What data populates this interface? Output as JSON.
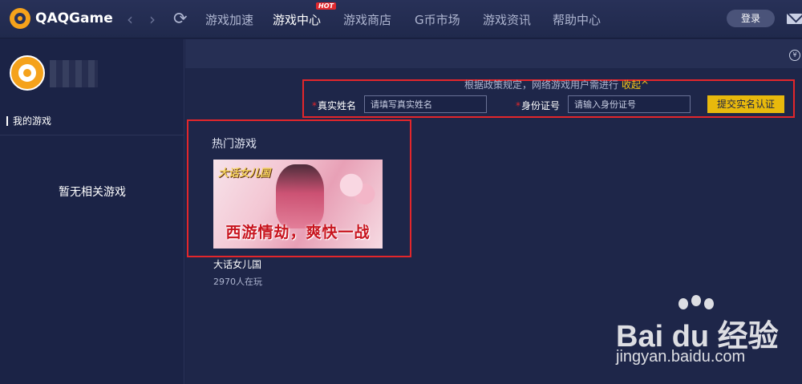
{
  "app": {
    "brand": "QAQGame",
    "hot_badge": "HOT",
    "login_label": "登录"
  },
  "nav": {
    "back_glyph": "‹",
    "forward_glyph": "›",
    "refresh_glyph": "⟳",
    "tabs": [
      {
        "label": "游戏加速",
        "active": false
      },
      {
        "label": "游戏中心",
        "active": true
      },
      {
        "label": "游戏商店",
        "active": false
      },
      {
        "label": "G币市场",
        "active": false
      },
      {
        "label": "游戏资讯",
        "active": false
      },
      {
        "label": "帮助中心",
        "active": false
      }
    ]
  },
  "sidebar": {
    "my_games_label": "我的游戏",
    "empty_text": "暂无相关游戏"
  },
  "realname": {
    "policy_text": "根据政策规定，网络游戏用户需进行",
    "collapse_label": "收起^",
    "required_mark": "*",
    "name_label": "真实姓名",
    "name_placeholder": "请填写真实姓名",
    "id_label": "身份证号",
    "id_placeholder": "请输入身份证号",
    "submit_label": "提交实名认证"
  },
  "hot_games": {
    "title": "热门游戏",
    "items": [
      {
        "name": "大话女儿国",
        "players": "2970人在玩",
        "banner_logo": "大话女儿国",
        "banner_slogan": "西游情劫，爽快一战"
      }
    ]
  },
  "watermark": {
    "brand": "Bai du 经验",
    "url": "jingyan.baidu.com"
  },
  "colors": {
    "accent_yellow": "#e8b90c",
    "highlight_red": "#e3262b",
    "background": "#1b2346"
  },
  "icons": [
    "qaq-logo-icon",
    "back-arrow-icon",
    "forward-arrow-icon",
    "refresh-icon",
    "mail-icon",
    "coin-icon",
    "avatar",
    "baidu-paw-icon"
  ]
}
